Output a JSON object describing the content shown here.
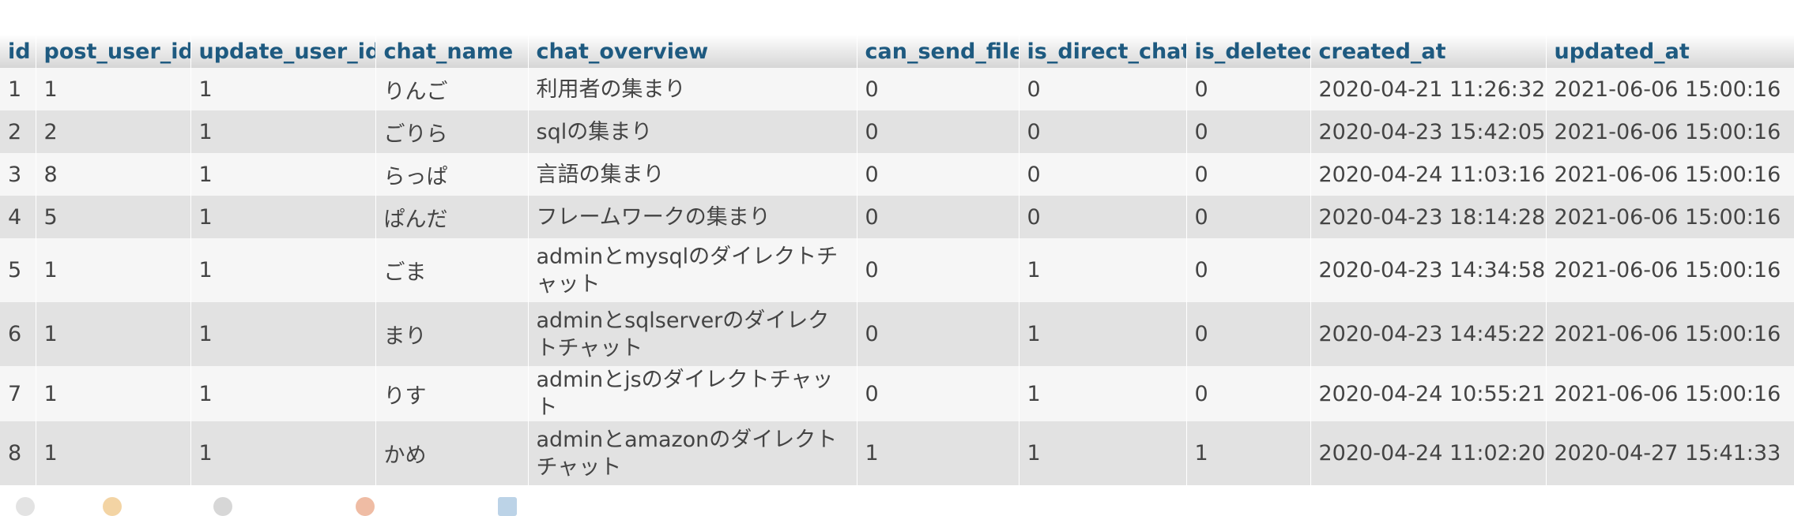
{
  "table": {
    "columns": [
      "id",
      "post_user_id",
      "update_user_id",
      "chat_name",
      "chat_overview",
      "can_send_file",
      "is_direct_chat",
      "is_deleted",
      "created_at",
      "updated_at"
    ],
    "rows": [
      [
        "1",
        "1",
        "1",
        "りんご",
        "利用者の集まり",
        "0",
        "0",
        "0",
        "2020-04-21 11:26:32",
        "2021-06-06 15:00:16"
      ],
      [
        "2",
        "2",
        "1",
        "ごりら",
        "sqlの集まり",
        "0",
        "0",
        "0",
        "2020-04-23 15:42:05",
        "2021-06-06 15:00:16"
      ],
      [
        "3",
        "8",
        "1",
        "らっぱ",
        "言語の集まり",
        "0",
        "0",
        "0",
        "2020-04-24 11:03:16",
        "2021-06-06 15:00:16"
      ],
      [
        "4",
        "5",
        "1",
        "ぱんだ",
        "フレームワークの集まり",
        "0",
        "0",
        "0",
        "2020-04-23 18:14:28",
        "2021-06-06 15:00:16"
      ],
      [
        "5",
        "1",
        "1",
        "ごま",
        "adminとmysqlのダイレクトチャット",
        "0",
        "1",
        "0",
        "2020-04-23 14:34:58",
        "2021-06-06 15:00:16"
      ],
      [
        "6",
        "1",
        "1",
        "まり",
        "adminとsqlserverのダイレクトチャット",
        "0",
        "1",
        "0",
        "2020-04-23 14:45:22",
        "2021-06-06 15:00:16"
      ],
      [
        "7",
        "1",
        "1",
        "りす",
        "adminとjsのダイレクトチャット",
        "0",
        "1",
        "0",
        "2020-04-24 10:55:21",
        "2021-06-06 15:00:16"
      ],
      [
        "8",
        "1",
        "1",
        "かめ",
        "adminとamazonのダイレクトチャット",
        "1",
        "1",
        "1",
        "2020-04-24 11:02:20",
        "2020-04-27 15:41:33"
      ]
    ]
  },
  "colors": {
    "header_text": "#1e5a80",
    "row_light": "#f6f6f6",
    "row_dark": "#e2e2e2"
  }
}
